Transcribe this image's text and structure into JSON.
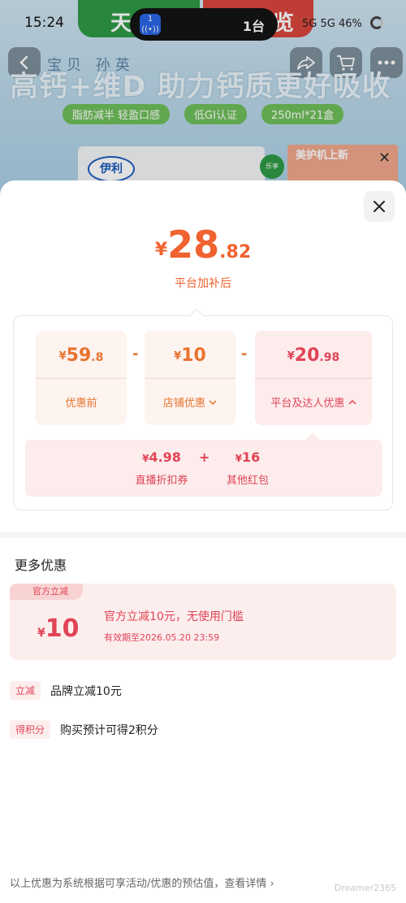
{
  "status_bar": {
    "time": "15:24",
    "island_app_badge": "1",
    "island_text": "1台",
    "network_right": "5G 5G 46%"
  },
  "background_page": {
    "banner_left": "天",
    "banner_right": "览",
    "brand_line": "宝贝 孙英",
    "headline": "高钙+维D 助力钙质更好吸收",
    "tags": [
      "脂肪减半 轻盈口感",
      "低GI认证",
      "250ml*21盒"
    ],
    "product_logo": "伊利",
    "green_badge": "乐享",
    "ad_text": "美护机上新"
  },
  "sheet": {
    "final_price": {
      "currency": "¥",
      "integer": "28",
      "decimal": ".82"
    },
    "final_label": "平台加补后",
    "breakdown": {
      "original": {
        "currency": "¥",
        "integer": "59",
        "decimal": ".8",
        "label": "优惠前"
      },
      "store_discount": {
        "currency": "¥",
        "integer": "10",
        "decimal": "",
        "label": "店铺优惠"
      },
      "platform_discount": {
        "currency": "¥",
        "integer": "20",
        "decimal": ".98",
        "label": "平台及达人优惠"
      },
      "minus": "-",
      "sub_items": [
        {
          "amount": "4.98",
          "label": "直播折扣券"
        },
        {
          "amount": "16",
          "label": "其他红包"
        }
      ],
      "plus": "+"
    },
    "more_title": "更多优惠",
    "coupon": {
      "tag": "官方立减",
      "currency": "¥",
      "amount": "10",
      "description": "官方立减10元，无使用门槛",
      "expiry": "有效期至2026.05.20 23:59"
    },
    "promos": [
      {
        "tag": "立减",
        "text": "品牌立减10元"
      },
      {
        "tag": "得积分",
        "text": "购买预计可得2积分"
      }
    ],
    "footer_note": "以上优惠为系统根据可享活动/优惠的预估值，查看详情 ›",
    "watermark": "Dreamer2365"
  },
  "colors": {
    "price_orange": "#f0622f",
    "discount_red": "#e04456",
    "box_bg": "#fdf3ef",
    "pink_bg": "#fdecec"
  },
  "icons": [
    "back-arrow-icon",
    "share-icon",
    "cart-icon",
    "more-icon",
    "close-icon",
    "chevron-down-icon",
    "chevron-up-icon",
    "wireless-icon"
  ]
}
